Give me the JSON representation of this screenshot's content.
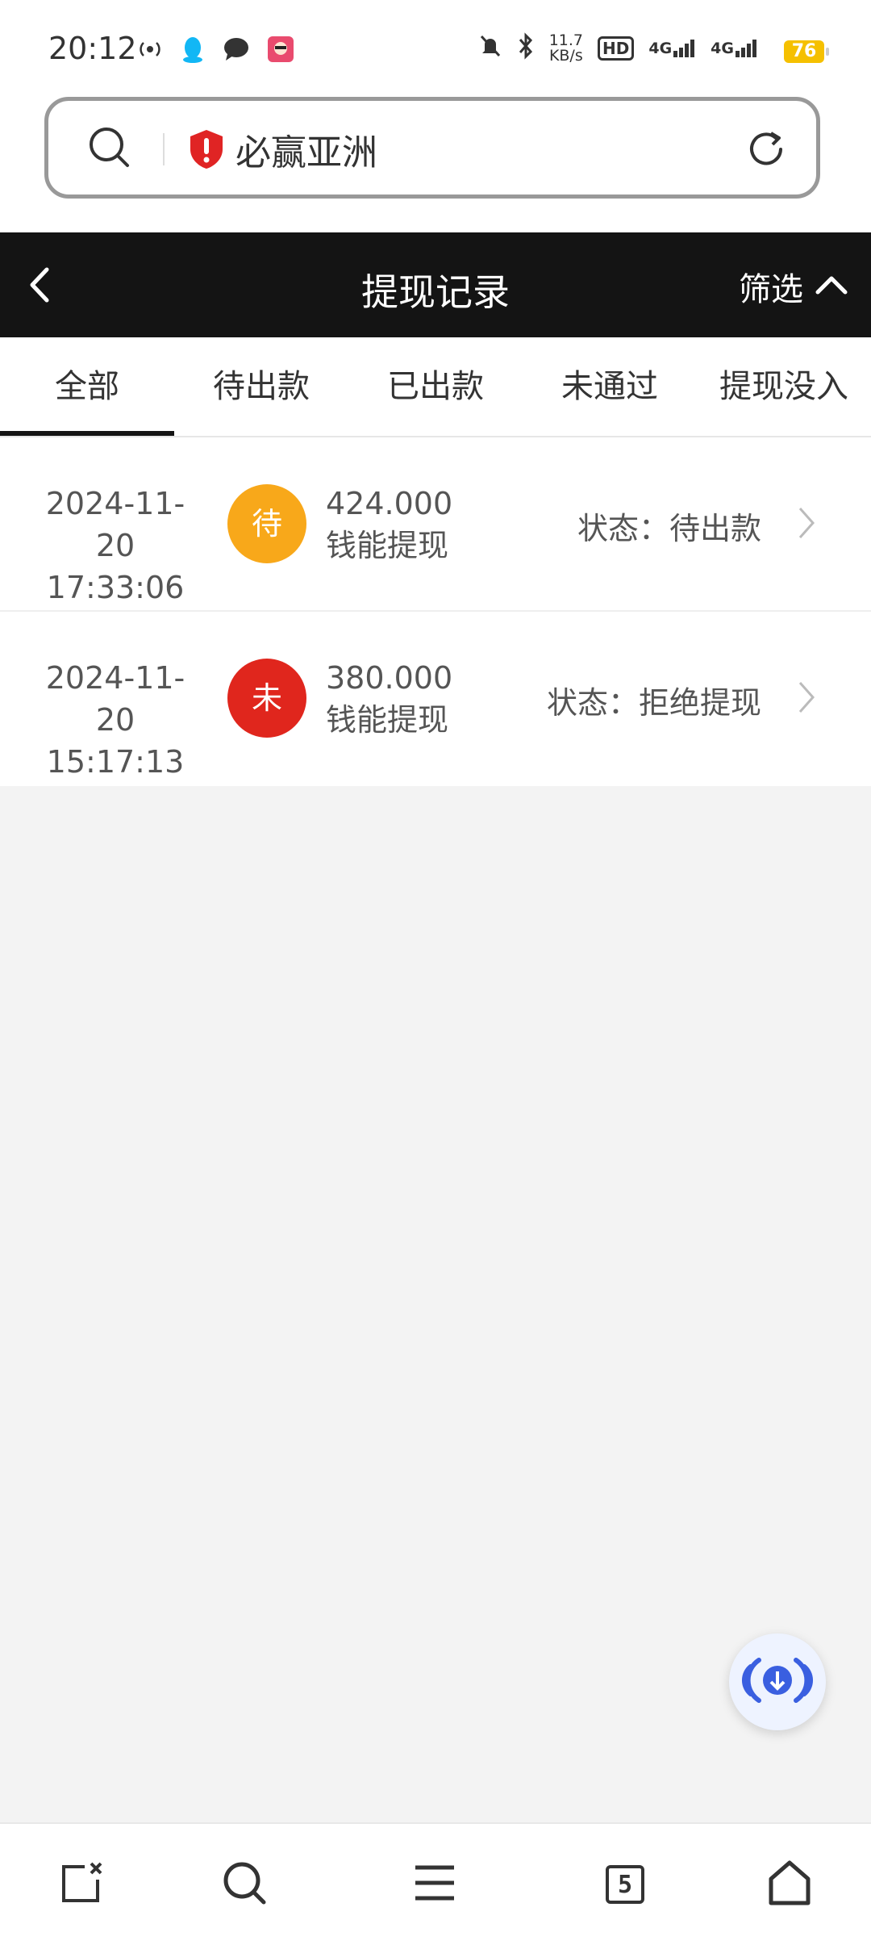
{
  "status_bar": {
    "time": "20:12",
    "net_speed": "11.7\nKB/s",
    "net_speed_value": "11.7",
    "net_speed_unit": "KB/s",
    "hd": "HD",
    "signal_1": "4G",
    "signal_2": "4G",
    "battery": "76",
    "battery_color": "#f5c000"
  },
  "address_bar": {
    "site_name": "必赢亚洲",
    "shield_color": "#e02424"
  },
  "header": {
    "title": "提现记录",
    "filter_label": "筛选"
  },
  "tabs": [
    {
      "label": "全部",
      "active": true
    },
    {
      "label": "待出款",
      "active": false
    },
    {
      "label": "已出款",
      "active": false
    },
    {
      "label": "未通过",
      "active": false
    },
    {
      "label": "提现没入",
      "active": false
    }
  ],
  "records": [
    {
      "date": "2024-11-20",
      "time": "17:33:06",
      "badge": "待",
      "badge_color": "#f8a81a",
      "amount": "424.000",
      "type": "钱能提现",
      "status": "状态：待出款"
    },
    {
      "date": "2024-11-20",
      "time": "15:17:13",
      "badge": "未",
      "badge_color": "#e0261d",
      "amount": "380.000",
      "type": "钱能提现",
      "status": "状态：拒绝提现"
    }
  ],
  "bottom_nav": {
    "tab_count": "5"
  },
  "icons": {
    "search": "search-icon",
    "shield": "shield-warning-icon",
    "refresh": "refresh-icon",
    "back": "back-arrow-icon",
    "filter": "chevron-up-icon",
    "chevron": "chevron-right-icon",
    "download": "download-icon",
    "close_tab": "close-page-icon",
    "menu": "menu-icon",
    "tabs": "tabs-icon",
    "home": "home-icon"
  }
}
